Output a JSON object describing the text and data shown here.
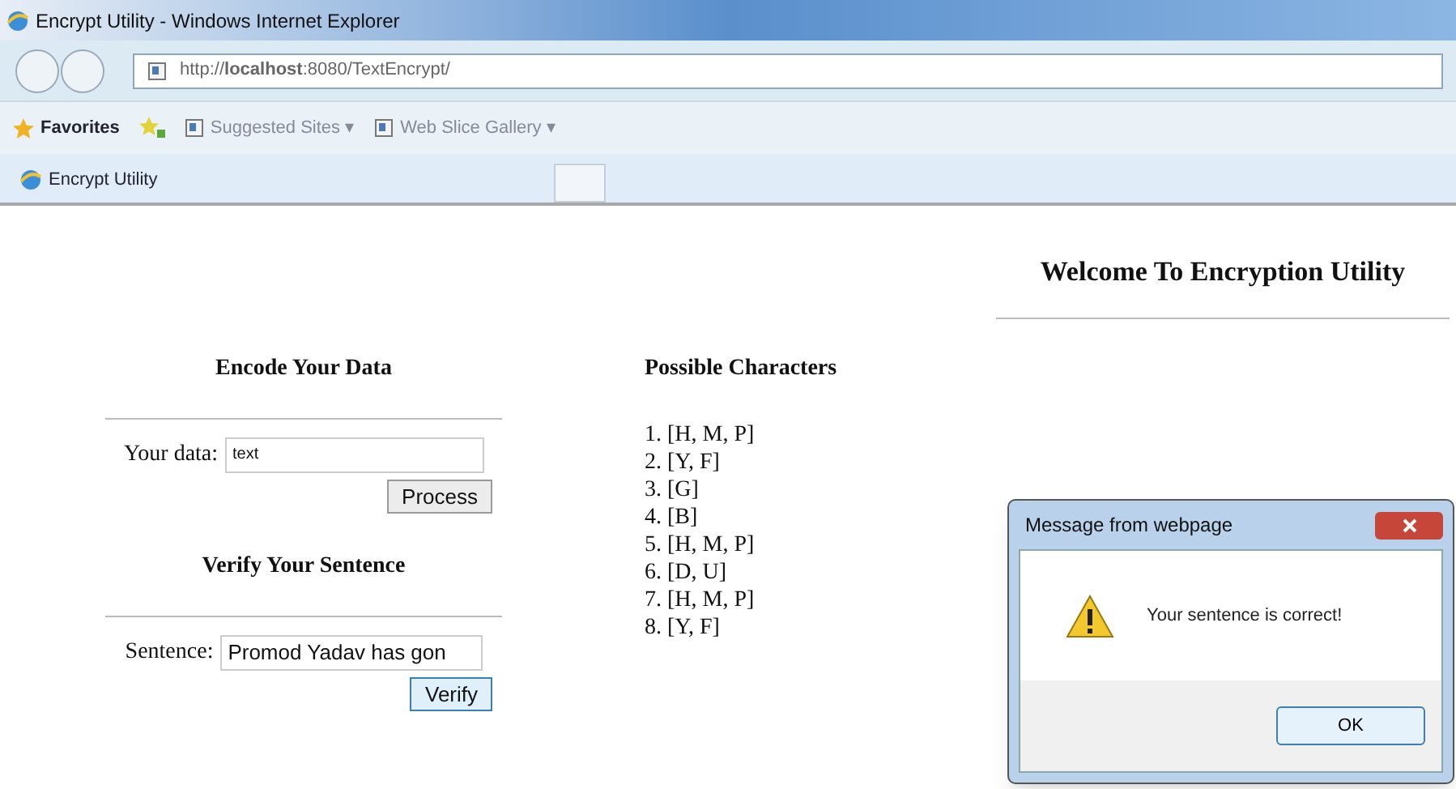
{
  "window": {
    "title": "Encrypt Utility - Windows Internet Explorer"
  },
  "address_bar": {
    "url": "http://**localhost**:8080/TextEncrypt/"
  },
  "favorites_bar": {
    "label": "Favorites",
    "links": [
      {
        "label": "Suggested Sites ▾"
      },
      {
        "label": "Web Slice Gallery ▾"
      }
    ]
  },
  "tabs": [
    {
      "label": "Encrypt Utility",
      "selected": true
    },
    {
      "selected": false
    }
  ],
  "page": {
    "heading": "Welcome To Encryption Utility",
    "encode": {
      "title": "Encode Your Data",
      "label": "Your data:",
      "value": "text",
      "button": "Process"
    },
    "verify": {
      "title": "Verify Your Sentence",
      "label": "Sentence:",
      "value": "Promod Yadav has gon",
      "button": "Verify"
    },
    "possible": {
      "title": "Possible Characters",
      "items": [
        "1. [H, M, P]",
        "2. [Y, F]",
        "3. [G]",
        "4. [B]",
        "5. [H, M, P]",
        "6. [D, U]",
        "7. [H, M, P]",
        "8. [Y, F]"
      ]
    }
  },
  "dialog": {
    "title": "Message from webpage",
    "message": "Your sentence is correct!",
    "button": "OK"
  }
}
